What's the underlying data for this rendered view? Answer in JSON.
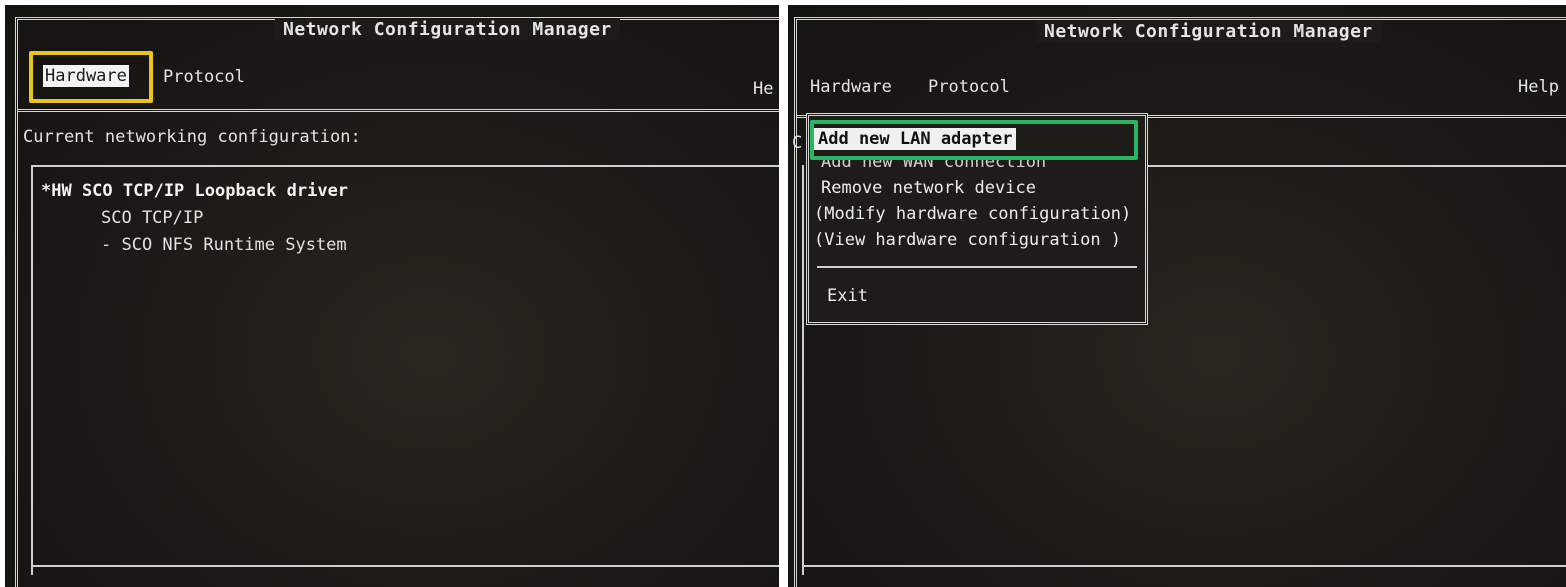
{
  "left": {
    "title": "Network Configuration Manager",
    "menu": {
      "hardware": "Hardware",
      "protocol": "Protocol",
      "help": "He"
    },
    "heading": "Current networking configuration:",
    "items": [
      "*HW SCO TCP/IP Loopback driver",
      "SCO TCP/IP",
      "- SCO NFS Runtime System"
    ]
  },
  "right": {
    "title": "Network Configuration Manager",
    "menu": {
      "hardware": "Hardware",
      "protocol": "Protocol",
      "help": "Help"
    },
    "partial_char": "C",
    "dropdown": {
      "items": [
        "Add new LAN adapter",
        "Add new WAN connection",
        "Remove network device",
        "(Modify hardware configuration)",
        "(View hardware configuration  )"
      ],
      "exit": "Exit"
    }
  },
  "colors": {
    "highlight_yellow": "#e8c51a",
    "highlight_green": "#2ab565",
    "screen": "#1b1915",
    "text": "#e2e2e2"
  }
}
